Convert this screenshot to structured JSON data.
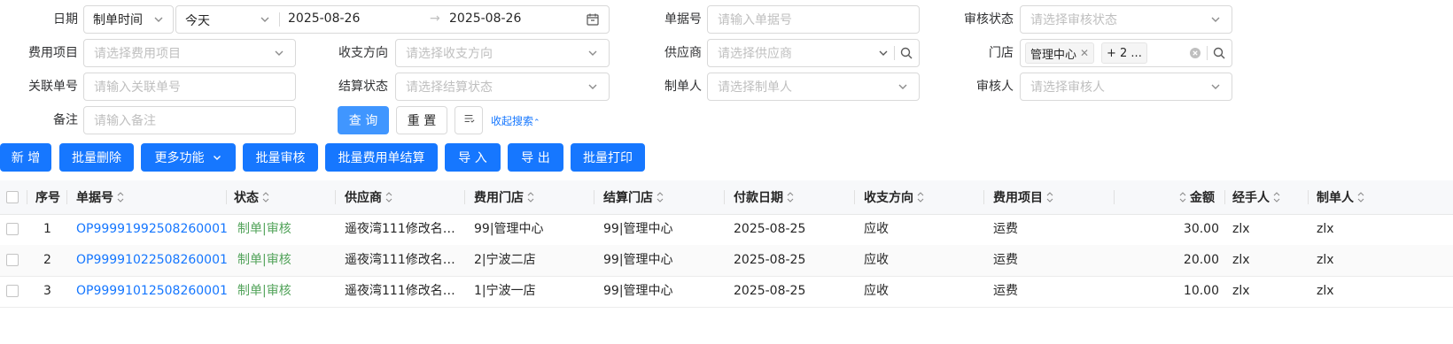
{
  "filters": {
    "date_label": "日期",
    "date_type": "制单时间",
    "date_range_preset": "今天",
    "date_start": "2025-08-26",
    "date_end": "2025-08-26",
    "doc_no_label": "单据号",
    "doc_no_placeholder": "请输入单据号",
    "audit_status_label": "审核状态",
    "audit_status_placeholder": "请选择审核状态",
    "fee_item_label": "费用项目",
    "fee_item_placeholder": "请选择费用项目",
    "direction_label": "收支方向",
    "direction_placeholder": "请选择收支方向",
    "supplier_label": "供应商",
    "supplier_placeholder": "请选择供应商",
    "store_label": "门店",
    "store_tag": "管理中心",
    "store_more": "+ 2 ...",
    "related_no_label": "关联单号",
    "related_no_placeholder": "请输入关联单号",
    "settle_status_label": "结算状态",
    "settle_status_placeholder": "请选择结算状态",
    "creator_label": "制单人",
    "creator_placeholder": "请选择制单人",
    "auditor_label": "审核人",
    "auditor_placeholder": "请选择审核人",
    "remark_label": "备注",
    "remark_placeholder": "请输入备注",
    "query_button": "查 询",
    "reset_button": "重 置",
    "collapse_link": "收起搜索"
  },
  "toolbar": {
    "add": "新 增",
    "batch_delete": "批量删除",
    "more": "更多功能",
    "batch_audit": "批量审核",
    "batch_settle": "批量费用单结算",
    "import": "导 入",
    "export": "导 出",
    "batch_print": "批量打印"
  },
  "table": {
    "headers": {
      "seq": "序号",
      "doc_no": "单据号",
      "status": "状态",
      "supplier": "供应商",
      "fee_store": "费用门店",
      "settle_store": "结算门店",
      "pay_date": "付款日期",
      "direction": "收支方向",
      "fee_item": "费用项目",
      "amount": "金额",
      "handler": "经手人",
      "creator": "制单人"
    },
    "rows": [
      {
        "seq": "1",
        "doc_no": "OP99991992508260001",
        "status": "制单|审核",
        "supplier": "遥夜湾111修改名…",
        "fee_store": "99|管理中心",
        "settle_store": "99|管理中心",
        "pay_date": "2025-08-25",
        "direction": "应收",
        "fee_item": "运费",
        "amount": "30.00",
        "handler": "zlx",
        "creator": "zlx"
      },
      {
        "seq": "2",
        "doc_no": "OP99991022508260001",
        "status": "制单|审核",
        "supplier": "遥夜湾111修改名…",
        "fee_store": "2|宁波二店",
        "settle_store": "99|管理中心",
        "pay_date": "2025-08-25",
        "direction": "应收",
        "fee_item": "运费",
        "amount": "20.00",
        "handler": "zlx",
        "creator": "zlx"
      },
      {
        "seq": "3",
        "doc_no": "OP99991012508260001",
        "status": "制单|审核",
        "supplier": "遥夜湾111修改名…",
        "fee_store": "1|宁波一店",
        "settle_store": "99|管理中心",
        "pay_date": "2025-08-25",
        "direction": "应收",
        "fee_item": "运费",
        "amount": "10.00",
        "handler": "zlx",
        "creator": "zlx"
      }
    ]
  },
  "colors": {
    "primary": "#1677ff",
    "link": "#1677ff",
    "status_green": "#52a35a"
  }
}
